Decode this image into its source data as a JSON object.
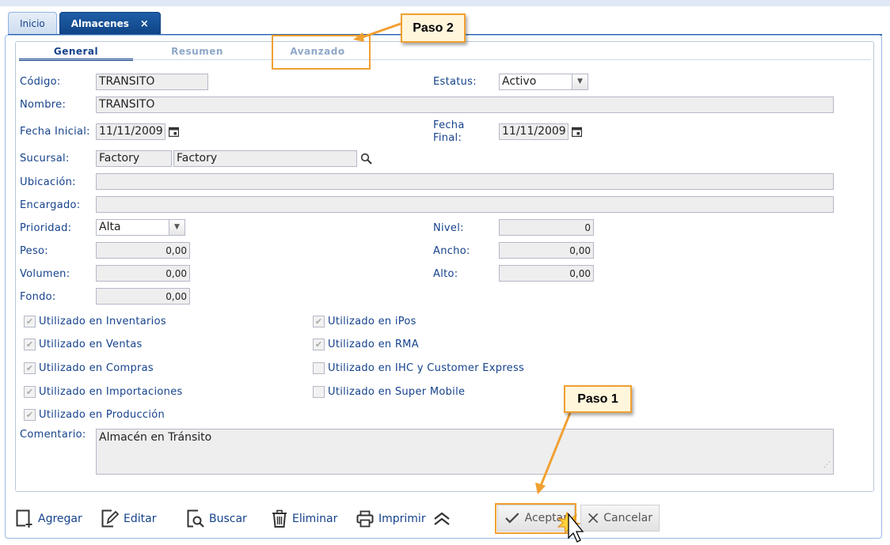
{
  "top_tabs": [
    {
      "label": "Inicio"
    },
    {
      "label": "Almacenes",
      "close": "×"
    }
  ],
  "sub_tabs": [
    {
      "label": "General"
    },
    {
      "label": "Resumen"
    },
    {
      "label": "Avanzado"
    }
  ],
  "form": {
    "codigo": {
      "label": "Código:",
      "value": "TRANSITO"
    },
    "estatus": {
      "label": "Estatus:",
      "value": "Activo"
    },
    "nombre": {
      "label": "Nombre:",
      "value": "TRANSITO"
    },
    "fecha_inicial": {
      "label": "Fecha Inicial:",
      "value": "11/11/2009"
    },
    "fecha_final": {
      "label_line1": "Fecha",
      "label_line2": "Final:",
      "value": "11/11/2009"
    },
    "sucursal": {
      "label": "Sucursal:",
      "code": "Factory",
      "name": "Factory"
    },
    "ubicacion": {
      "label": "Ubicación:",
      "value": ""
    },
    "encargado": {
      "label": "Encargado:",
      "value": ""
    },
    "prioridad": {
      "label": "Prioridad:",
      "value": "Alta"
    },
    "nivel": {
      "label": "Nivel:",
      "value": "0"
    },
    "peso": {
      "label": "Peso:",
      "value": "0,00"
    },
    "ancho": {
      "label": "Ancho:",
      "value": "0,00"
    },
    "volumen": {
      "label": "Volumen:",
      "value": "0,00"
    },
    "alto": {
      "label": "Alto:",
      "value": "0,00"
    },
    "fondo": {
      "label": "Fondo:",
      "value": "0,00"
    },
    "comentario": {
      "label": "Comentario:",
      "value": "Almacén en Tránsito"
    }
  },
  "checkboxes_left": [
    {
      "label": "Utilizado en Inventarios",
      "checked": true
    },
    {
      "label": "Utilizado en Ventas",
      "checked": true
    },
    {
      "label": "Utilizado en Compras",
      "checked": true
    },
    {
      "label": "Utilizado en Importaciones",
      "checked": true
    },
    {
      "label": "Utilizado en Producción",
      "checked": true
    }
  ],
  "checkboxes_right": [
    {
      "label": "Utilizado en iPos",
      "checked": true
    },
    {
      "label": "Utilizado en RMA",
      "checked": true
    },
    {
      "label": "Utilizado en IHC y Customer Express",
      "checked": false
    },
    {
      "label": "Utilizado en Super Mobile",
      "checked": false
    }
  ],
  "toolbar": {
    "agregar": "Agregar",
    "editar": "Editar",
    "buscar": "Buscar",
    "eliminar": "Eliminar",
    "imprimir": "Imprimir",
    "aceptar": "Aceptar",
    "cancelar": "Cancelar"
  },
  "callouts": {
    "paso1": "Paso 1",
    "paso2": "Paso 2"
  },
  "colors": {
    "label_blue": "#15428b",
    "callout_orange": "#f0a030",
    "callout_fill": "#fff6dc"
  }
}
